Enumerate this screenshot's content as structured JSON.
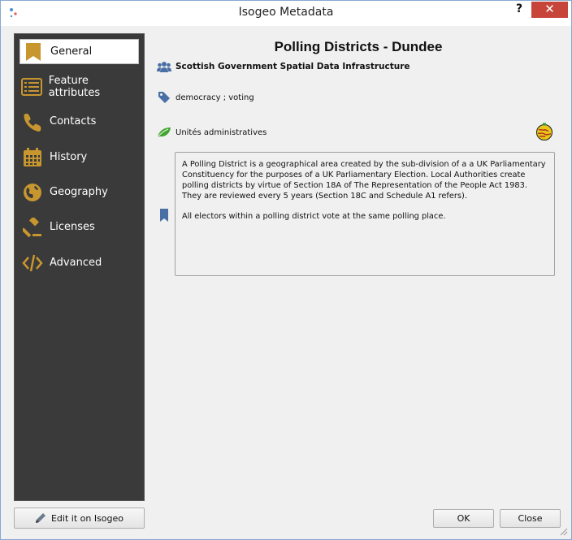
{
  "window": {
    "title": "Isogeo Metadata",
    "help_label": "?",
    "close_label": "✕"
  },
  "sidebar": {
    "items": [
      {
        "label": "General",
        "icon": "bookmark-icon",
        "active": true
      },
      {
        "label": "Feature attributes",
        "icon": "list-icon"
      },
      {
        "label": "Contacts",
        "icon": "phone-icon"
      },
      {
        "label": "History",
        "icon": "calendar-icon"
      },
      {
        "label": "Geography",
        "icon": "globe-icon"
      },
      {
        "label": "Licenses",
        "icon": "gavel-icon"
      },
      {
        "label": "Advanced",
        "icon": "code-icon"
      }
    ],
    "edit_button": "Edit it on Isogeo"
  },
  "main": {
    "title": "Polling Districts - Dundee",
    "organization": "Scottish Government Spatial Data Infrastructure",
    "keywords": "democracy ; voting",
    "theme": "Unités administratives",
    "description": {
      "paragraph1": "A Polling District is a geographical area created by the sub-division of a a UK Parliamentary Constituency for the purposes of a UK Parliamentary Election. Local Authorities create polling districts by virtue of Section 18A of The Representation of the People Act 1983. They are reviewed every 5 years (Section 18C and Schedule A1 refers).",
      "paragraph2": "All electors within a polling district vote at the same polling place."
    }
  },
  "footer": {
    "ok_label": "OK",
    "close_label": "Close"
  },
  "colors": {
    "accent_gold": "#c8962e",
    "icon_blue": "#4a6fa5",
    "sidebar_bg": "#3a3a3a",
    "close_red": "#c7443a",
    "leaf_green": "#3fa52c"
  }
}
